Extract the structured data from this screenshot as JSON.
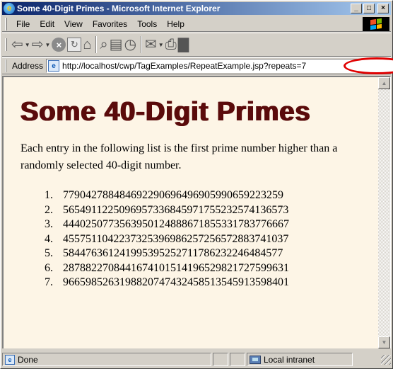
{
  "window": {
    "title": "Some 40-Digit Primes - Microsoft Internet Explorer",
    "buttons": {
      "minimize": "_",
      "maximize": "□",
      "close": "×"
    }
  },
  "menubar": {
    "items": [
      {
        "label": "File",
        "key": "F"
      },
      {
        "label": "Edit",
        "key": "E"
      },
      {
        "label": "View",
        "key": "V"
      },
      {
        "label": "Favorites",
        "key": "a"
      },
      {
        "label": "Tools",
        "key": "T"
      },
      {
        "label": "Help",
        "key": "H"
      }
    ]
  },
  "toolbar": {
    "icons": [
      "back-icon",
      "forward-icon",
      "stop-icon",
      "refresh-icon",
      "home-icon",
      "search-icon",
      "favorites-icon",
      "history-icon",
      "mail-icon",
      "print-icon",
      "edit-icon"
    ]
  },
  "address": {
    "label": "Address",
    "url": "http://localhost/cwp/TagExamples/RepeatExample.jsp?repeats=7",
    "highlighted_segment": "?repeats=7"
  },
  "page": {
    "heading": "Some 40-Digit Primes",
    "intro": "Each entry in the following list is the first prime number higher than a randomly selected 40-digit number.",
    "primes": [
      "7790427884846922906964969059906592232​59",
      "5654911225096957336845971755232574136573",
      "4440250773563950124888671855331783776667",
      "4557511042237325396986257256572883741037",
      "5844763612419953952527117862322464845​77",
      "2878822708441674101514196529821727599631",
      "9665985263198820747432458513545913598401"
    ]
  },
  "statusbar": {
    "status": "Done",
    "zone": "Local intranet"
  },
  "colors": {
    "heading": "#5a0b0b",
    "page_background": "#fdf5e6",
    "titlebar_start": "#0a246a",
    "highlight_ring": "#e00000"
  }
}
